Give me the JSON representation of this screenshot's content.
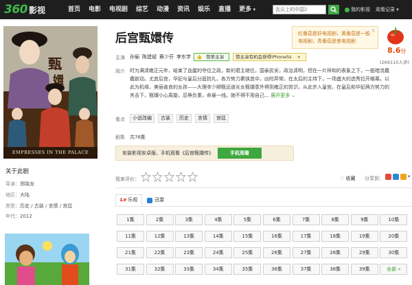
{
  "nav": {
    "logo_num": "360",
    "logo_txt": "影视",
    "items": [
      "首页",
      "电影",
      "电视剧",
      "综艺",
      "动漫",
      "资讯",
      "娱乐",
      "直播",
      "更多"
    ],
    "search_placeholder": "舌尖上的中国2",
    "my_video": "我的影视",
    "history": "观看记录"
  },
  "poster": {
    "band_text": "EMPRESSES IN THE PALACE"
  },
  "title": "后宫甄嬛传",
  "ad": {
    "text": "红番茄是好电视剧，黄番茄是一般电视剧，青番茄是差电视剧",
    "close": "×"
  },
  "rating": {
    "score": "8.6",
    "unit": "分",
    "votes": "(269110人评)"
  },
  "cast": {
    "label": "主演",
    "names": [
      "孙俪",
      "陈建斌",
      "蔡少芬",
      "李东学"
    ],
    "like_chip": "赞美主演",
    "promo_chip": "赞主演有机会获得iPhone5s",
    "promo_close": "×"
  },
  "synopsis": {
    "label": "简介",
    "text": "时为满清雍正元年，结束了血腥的夺位之政，新的君主继位，国泰民安，政治清明，但在一片祥和的表象之下，一股暗流蠢蠢欲动。尤其后宫，华妃与皇后分庭抗礼，各方势力裹挟其中，凶险异常。在太后的主持下，一场盛大的选秀拉开帷幕。以此为机缘，美丽善良的女孩——大理寺少卿甄远道长女甄嬛意外得到雍正的赏识，从此步入皇宫。在皇后和华妃两方势力的夹击下，甄嬛小心周旋，忍辱负重，命悬一线。她不得不用自己…",
    "expand": "展开更多"
  },
  "tags": {
    "label": "看点",
    "items": [
      "小说改编",
      "古装",
      "历史",
      "言情",
      "宫廷"
    ]
  },
  "episodes_info": {
    "label": "剧集",
    "text": "共76集"
  },
  "mobile": {
    "text": "安装影视安卓版，手机观看《后宫甄嬛传》",
    "button": "手机观看"
  },
  "about": {
    "title": "关于此剧",
    "rows": [
      {
        "k": "导演：",
        "v": "郑晓龙"
      },
      {
        "k": "地区：",
        "v": "大陆"
      },
      {
        "k": "类型：",
        "v": "历史 / 古装 / 言情 / 宫廷"
      },
      {
        "k": "年代：",
        "v": "2012"
      }
    ]
  },
  "user_rating": {
    "label": "我来评价：",
    "stars": 5
  },
  "fav": "收藏",
  "share": {
    "label": "分享到：",
    "more": "▾"
  },
  "sources": {
    "tabs": [
      "乐视",
      "迅雷"
    ],
    "le_mark": "Le"
  },
  "episodes": {
    "items": [
      "1集",
      "2集",
      "3集",
      "4集",
      "5集",
      "6集",
      "7集",
      "8集",
      "9集",
      "10集",
      "11集",
      "12集",
      "13集",
      "14集",
      "15集",
      "16集",
      "17集",
      "18集",
      "19集",
      "20集",
      "21集",
      "22集",
      "23集",
      "24集",
      "25集",
      "26集",
      "27集",
      "28集",
      "29集",
      "30集",
      "31集",
      "32集",
      "33集",
      "34集",
      "35集",
      "36集",
      "37集",
      "38集",
      "39集"
    ],
    "all": "全部"
  },
  "colors": {
    "nav_bg": "#1e1e1e",
    "brand_green": "#3fb94b",
    "score": "#e24b12"
  }
}
